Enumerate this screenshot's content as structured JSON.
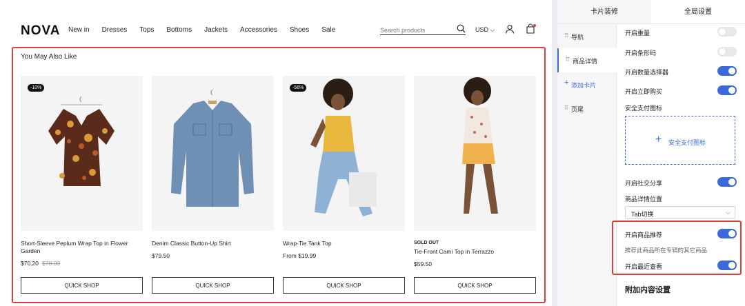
{
  "store": {
    "logo": "NOVA",
    "nav": [
      "New in",
      "Dresses",
      "Tops",
      "Bottoms",
      "Jackets",
      "Accessories",
      "Shoes",
      "Sale"
    ],
    "search_placeholder": "Search products",
    "currency": "USD",
    "section_title": "You May Also Like",
    "quick_shop_label": "QUICK SHOP",
    "products": [
      {
        "name": "Short-Sleeve Peplum Wrap Top in Flower Garden",
        "price": "$70.20",
        "old_price": "$78.00",
        "badge": "-10%",
        "sold_out": ""
      },
      {
        "name": "Denim Classic Button-Up Shirt",
        "price": "$79.50",
        "old_price": "",
        "badge": "",
        "sold_out": ""
      },
      {
        "name": "Wrap-Tie Tank Top",
        "price": "From $19.99",
        "old_price": "",
        "badge": "-56%",
        "sold_out": ""
      },
      {
        "name": "Tie-Front Cami Top in Terrazzo",
        "price": "$59.50",
        "old_price": "",
        "badge": "",
        "sold_out": "SOLD OUT"
      }
    ]
  },
  "panel": {
    "tabs": [
      "卡片装修",
      "全局设置"
    ],
    "sidenav": [
      "导航",
      "商品详情",
      "添加卡片",
      "页尾"
    ],
    "settings": {
      "weight": "开启重量",
      "barcode": "开启条形码",
      "qty_selector": "开启数量选择器",
      "buy_now": "开启立即购买",
      "pay_icon": "安全支付图标",
      "pay_icon_upload": "安全支付图标",
      "social_share": "开启社交分享",
      "detail_position": "商品详情位置",
      "detail_position_value": "Tab切换",
      "recommend": "开启商品推荐",
      "recommend_hint": "推荐此商品所在专辑的其它商品",
      "recently_viewed": "开启最近查看",
      "extra_section": "附加内容设置"
    },
    "toggles": {
      "weight": false,
      "barcode": false,
      "qty_selector": true,
      "buy_now": true,
      "social_share": true,
      "recommend": true,
      "recently_viewed": true
    },
    "accent_color": "#3b6ad8",
    "highlight_color": "#d9403a"
  }
}
